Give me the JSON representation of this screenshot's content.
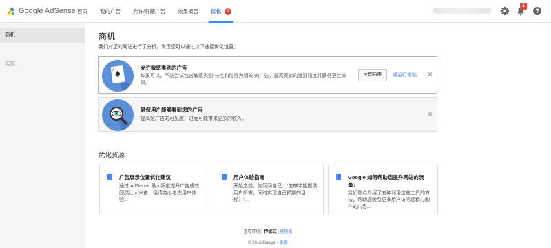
{
  "header": {
    "app_name": "Google AdSense",
    "nav": [
      {
        "label": "首页"
      },
      {
        "label": "我的广告"
      },
      {
        "label": "允许/屏蔽广告"
      },
      {
        "label": "效果报告"
      },
      {
        "label": "优化",
        "badge": "1",
        "active": true
      }
    ],
    "notifications_count": "1",
    "icons": [
      "settings-icon",
      "notifications-bell-icon",
      "help-icon"
    ]
  },
  "sidebar": {
    "items": [
      {
        "label": "商机",
        "active": true
      },
      {
        "label": "实验"
      }
    ]
  },
  "main": {
    "title": "商机",
    "description": "我们对您的网站进行了分析，发现您可以通过以下途径优化设置：",
    "opportunities": [
      {
        "title": "允许敏感类别的广告",
        "text": "如果可以，不妨尝试包含敏感类别“与性和性行为相关”的广告，提高竞价的激烈程度并获得更佳效果。",
        "button": "立即启用",
        "link": "或运行实验",
        "icon": "playing-card-icon"
      },
      {
        "title": "确保用户能够看到您的广告",
        "text": "提高您广告的可见度，进而可能带来更多的收入。",
        "icon": "magnifier-eye-icon"
      }
    ],
    "resources_title": "优化资源",
    "resources": [
      {
        "title": "广告展示位置优化建议",
        "text": "通过 AdSense 最大限度提升广告成效固然让人兴奋，但请务必考虑用户体验..."
      },
      {
        "title": "用户体验指南",
        "text": "开始之前，先问问自己：“怎样才能提供用户所需，同时实现自己预期的目标？”..."
      },
      {
        "title": "Google 如何帮助您提升网站的流量？",
        "text": "我们重点介绍了五种利用这些工具的方法，帮助您吸引更多用户访问您精心制作的内容..."
      }
    ]
  },
  "footer": {
    "view_prefix": "查看环境：",
    "view_current": "传统式",
    "view_sep": " | ",
    "view_other": "经常版",
    "copyright": "© 2016 Google - ",
    "terms": "条款"
  },
  "colors": {
    "accent": "#4285f4",
    "badge": "#dd4b39",
    "icon_circle": "#5b8fd8"
  }
}
